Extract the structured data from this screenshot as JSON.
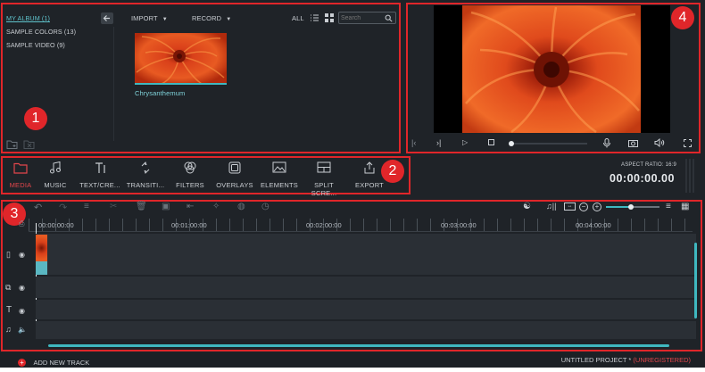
{
  "media_panel": {
    "albums": [
      "MY ALBUM (1)",
      "SAMPLE COLORS (13)",
      "SAMPLE VIDEO (9)"
    ],
    "import_label": "IMPORT",
    "record_label": "RECORD",
    "all_label": "ALL",
    "search_placeholder": "Search",
    "clip_name": "Chrysanthemum"
  },
  "toolbar": {
    "items": [
      "MEDIA",
      "MUSIC",
      "TEXT/CRE...",
      "TRANSITI...",
      "FILTERS",
      "OVERLAYS",
      "ELEMENTS",
      "SPLIT SCRE...",
      "EXPORT"
    ],
    "active": "MEDIA"
  },
  "preview": {
    "aspect_ratio": "ASPECT RATIO: 16:9",
    "timecode": "00:00:00.00",
    "progress": 0.0
  },
  "timeline": {
    "ticks": [
      "00:00:00:00",
      "00:01:00:00",
      "00:02:00:00",
      "00:03:00:00",
      "00:04:00:00"
    ],
    "add_track_label": "ADD NEW TRACK",
    "project_name": "UNTITLED PROJECT *",
    "project_status": "(UNREGISTERED)"
  },
  "callouts": [
    "1",
    "2",
    "3",
    "4"
  ],
  "colors": {
    "background": "#1f2328",
    "accent": "#3fb8c0",
    "active": "#e2464b",
    "callout": "#e0262a"
  }
}
